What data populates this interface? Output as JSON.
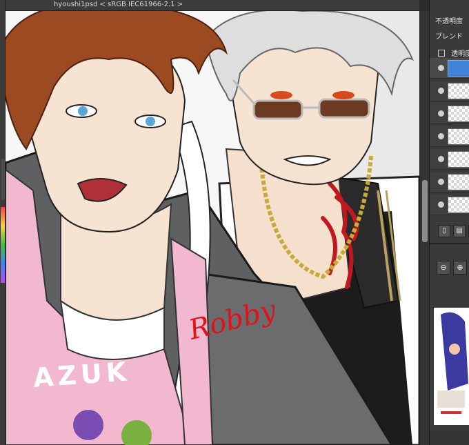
{
  "document": {
    "tab_title": "hyoushi1psd < sRGB IEC61966-2.1 >"
  },
  "layer_panel": {
    "opacity_label": "不透明度",
    "blend_label": "ブレンド",
    "lock_transparency_label": "透明度",
    "layers": [
      {
        "selected": true,
        "visible": true
      },
      {
        "selected": false,
        "visible": true
      },
      {
        "selected": false,
        "visible": true
      },
      {
        "selected": false,
        "visible": true
      },
      {
        "selected": false,
        "visible": true
      },
      {
        "selected": false,
        "visible": true
      },
      {
        "selected": false,
        "visible": true
      }
    ],
    "buttons": [
      {
        "icon": "new-layer-icon",
        "glyph": "▯"
      },
      {
        "icon": "new-document-icon",
        "glyph": "▤"
      },
      {
        "icon": "folder-icon",
        "glyph": "▭"
      }
    ]
  },
  "navigator": {
    "tools": [
      {
        "icon": "zoom-out-icon",
        "glyph": "⊖"
      },
      {
        "icon": "zoom-in-icon",
        "glyph": "⊕"
      }
    ]
  },
  "artwork": {
    "apron_text": "AZUK",
    "signature": "Robby",
    "colors": {
      "hair_left": "#9b4a22",
      "hair_right": "#d9d9d9",
      "apron": "#f2b8cf",
      "jacket": "#5e6062",
      "tattoo": "#c0181f",
      "chain": "#c9a93a",
      "skin": "#f6e3d1",
      "eyes_left": "#5aa6d6",
      "eyes_right": "#d64a1f",
      "signature": "#e1121b"
    }
  }
}
